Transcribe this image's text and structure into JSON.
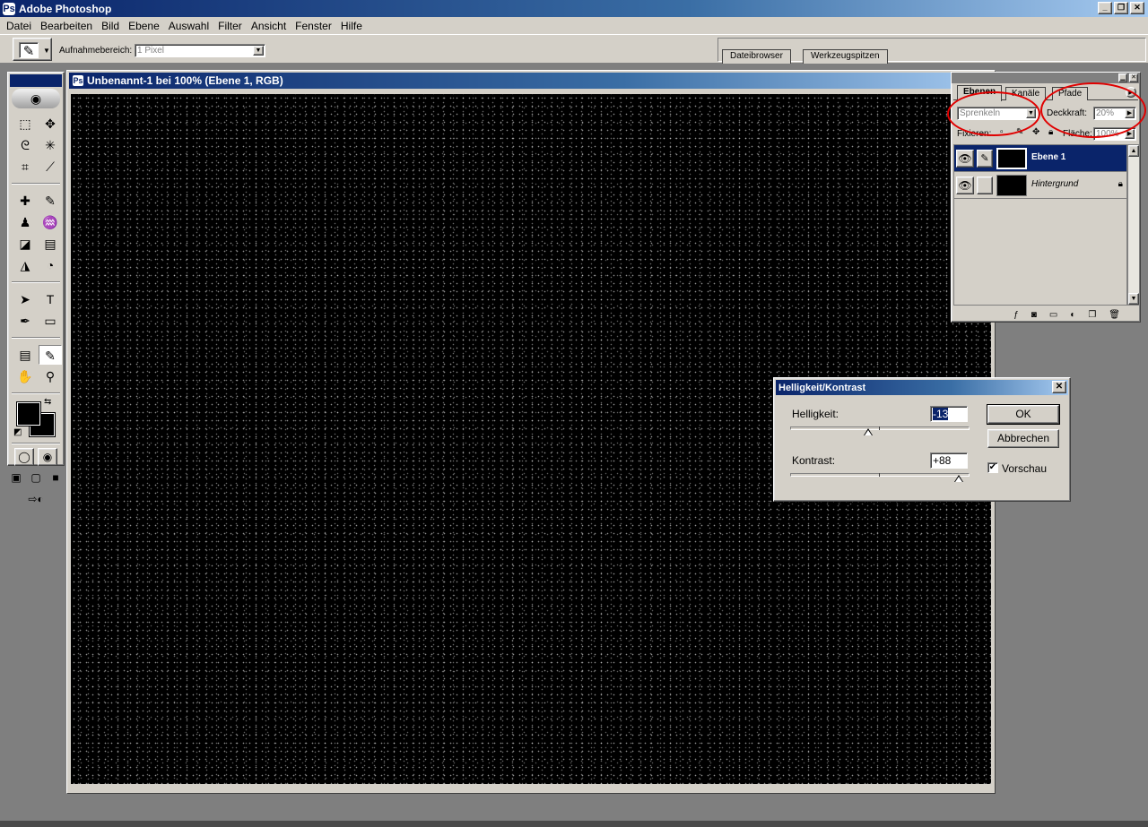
{
  "app": {
    "title": "Adobe Photoshop",
    "window_buttons": [
      "_",
      "❐",
      "✕"
    ]
  },
  "menu": [
    "Datei",
    "Bearbeiten",
    "Bild",
    "Ebene",
    "Auswahl",
    "Filter",
    "Ansicht",
    "Fenster",
    "Hilfe"
  ],
  "options_bar": {
    "tool_icon": "eyedropper-icon",
    "sample_label": "Aufnahmebereich:",
    "sample_value": "1 Pixel",
    "well_tabs": [
      "Dateibrowser",
      "Werkzeugspitzen"
    ]
  },
  "document": {
    "title": "Unbenannt-1 bei 100% (Ebene 1, RGB)"
  },
  "layers_palette": {
    "tabs": [
      "Ebenen",
      "Kanäle",
      "Pfade"
    ],
    "blend_mode": "Sprenkeln",
    "opacity_label": "Deckkraft:",
    "opacity_value": "20%",
    "lock_label": "Fixieren:",
    "fill_label": "Fläche:",
    "fill_value": "100%",
    "layers": [
      {
        "name": "Ebene 1",
        "selected": true
      },
      {
        "name": "Hintergrund",
        "selected": false,
        "locked": true
      }
    ]
  },
  "dialog": {
    "title": "Helligkeit/Kontrast",
    "brightness_label": "Helligkeit:",
    "brightness_value": "-13",
    "contrast_label": "Kontrast:",
    "contrast_value": "+88",
    "ok_label": "OK",
    "cancel_label": "Abbrechen",
    "preview_label": "Vorschau",
    "preview_checked": true
  },
  "colors": {
    "title_active": "#0a246a",
    "face": "#d4d0c8",
    "workspace": "#7f7f7f",
    "canvas": "#000000",
    "annotation_red": "#e00000"
  }
}
